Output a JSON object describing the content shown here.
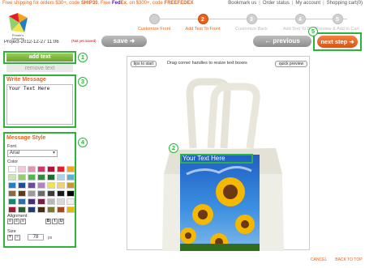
{
  "topbar": {
    "promo_prefix": "Free shipping for orders $30+, code",
    "promo_code1": "SHIP30",
    "promo_mid": "Free",
    "fedex_fed": "Fed",
    "fedex_ex": "Ex.",
    "promo_mid2": "on $300+, code",
    "promo_code2": "FREEFEDEX",
    "links": [
      "Bookmark us",
      "Order status",
      "My account",
      "Shopping cart(0)"
    ]
  },
  "logo": {
    "text_line1": "Printer's",
    "text_line2": "Artworks"
  },
  "steps": [
    {
      "num": "",
      "label": "Customize Front",
      "state": "done"
    },
    {
      "num": "2",
      "label": "Add Text To Front",
      "state": "active"
    },
    {
      "num": "3",
      "label": "Customize Back",
      "state": "todo"
    },
    {
      "num": "4",
      "label": "Add Text To Back",
      "state": "todo"
    },
    {
      "num": "5",
      "label": "Preview & Add to Cart",
      "state": "todo"
    }
  ],
  "project": {
    "name": "Project-2012-12-27 11:06",
    "status": "(Not yet saved)"
  },
  "buttons": {
    "save": "save ➜",
    "previous": "← previous",
    "next_step": "next step ➜",
    "add_text": "add text",
    "remove_text": "remove text",
    "tips": "tips to start",
    "quick_preview": "quick preview"
  },
  "callouts": [
    "1",
    "2",
    "3",
    "4",
    "5"
  ],
  "write_message": {
    "title": "Write Message",
    "value": "Your Text Here"
  },
  "message_style": {
    "title": "Message Style",
    "font_label": "Font",
    "font_value": "Arial",
    "color_label": "Color",
    "alignment_label": "Alignment",
    "size_label": "Size",
    "size_value": "78",
    "size_unit": "px",
    "palette": [
      "#ffffff",
      "#f7c6d9",
      "#e891b6",
      "#d6336c",
      "#b10f3c",
      "#e81c23",
      "#f5a31a",
      "#c7e7b3",
      "#8fd16b",
      "#4fb848",
      "#2a8f3b",
      "#1b6e2e",
      "#a7d3e8",
      "#5ab0d9",
      "#1e7ec8",
      "#1c4f9c",
      "#6f4aa0",
      "#b57fc2",
      "#f2e34c",
      "#f7d06b",
      "#c8962a",
      "#8a6b3e",
      "#5b3a1e",
      "#9c9c9c",
      "#6b6b6b",
      "#3c3c3c",
      "#1a1a1a",
      "#000000",
      "#0e8a6e",
      "#2b6fa8",
      "#4b2c7a",
      "#7a1d4a",
      "#b8b8b8",
      "#d9d9d9",
      "#eeeeee",
      "#9b1b30",
      "#2c5f2d",
      "#1d3e6e",
      "#4a2a10",
      "#7a7a2a",
      "#a34a1b",
      "#e6b800"
    ],
    "align_buttons": [
      "≡",
      "≡",
      "≡",
      "B",
      "I",
      "U"
    ]
  },
  "canvas": {
    "drag_hint": "Drag corner handles to resize text boxes",
    "text_on_product": "Your Text Here"
  },
  "footer": {
    "cancel": "CANCEL",
    "back_to_top": "BACK TO TOP"
  }
}
